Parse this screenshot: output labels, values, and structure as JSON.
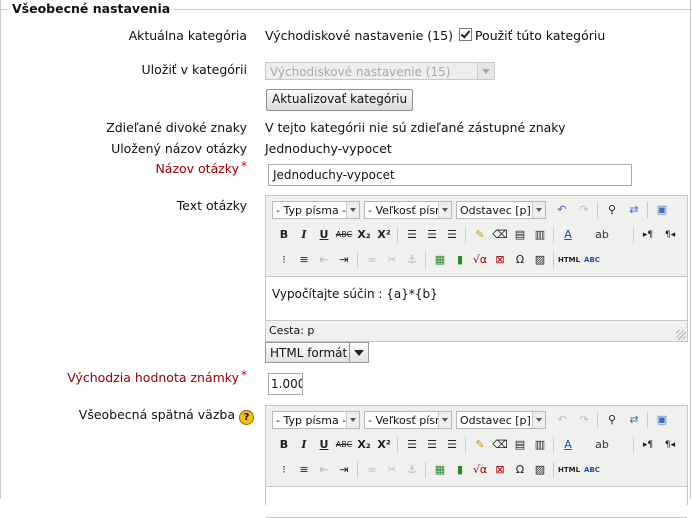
{
  "section": {
    "legend": "Všeobecné nastavenia"
  },
  "category": {
    "current_label": "Aktuálna kategória",
    "current_value": "Východiskové nastavenie (15)",
    "use_checkbox_label": "Použiť túto kategóriu",
    "use_checked": true,
    "save_in_label": "Uložiť v kategórii",
    "save_in_value": "Východiskové nastavenie (15)",
    "update_button": "Aktualizovať kategóriu"
  },
  "wildcards": {
    "label": "Zdieľané divoké znaky",
    "value": "V tejto kategórii nie sú zdieľané zástupné znaky"
  },
  "saved_name": {
    "label": "Uložený názov otázky",
    "value": "Jednoduchy-vypocet"
  },
  "question_name": {
    "label": "Názov otázky",
    "required_mark": "*",
    "value": "Jednoduchy-vypocet"
  },
  "question_text": {
    "label": "Text otázky",
    "font_family": "- Typ písma -",
    "font_size": "- Veľkosť písm",
    "paragraph": "Odstavec [p]",
    "content": "Vypočítajte súčin : {a}*{b}",
    "path": "Cesta: p",
    "format": "HTML formát"
  },
  "default_grade": {
    "label": "Východzia hodnota známky",
    "required_mark": "*",
    "value": "1.000"
  },
  "general_feedback": {
    "label": "Všeobecná spätná väzba",
    "help_icon": "?",
    "font_family": "- Typ písma -",
    "font_size": "- Veľkosť písm",
    "paragraph": "Odstavec [p]"
  },
  "toolbar": {
    "bold": "B",
    "italic": "I",
    "underline": "U",
    "strike": "ABC",
    "sub": "X₂",
    "sup": "X²",
    "html": "HTML",
    "omega": "Ω",
    "spell": "ABC"
  }
}
